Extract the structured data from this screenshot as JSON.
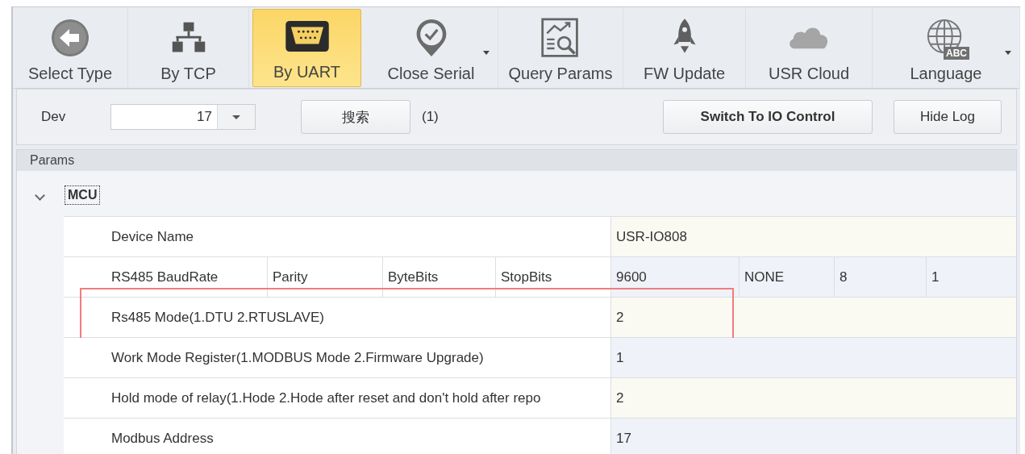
{
  "toolbar": {
    "buttons": [
      {
        "kind": "back",
        "label": "Select Type",
        "selected": false,
        "dropdown": false
      },
      {
        "kind": "network",
        "label": "By TCP",
        "selected": false,
        "dropdown": false
      },
      {
        "kind": "serial",
        "label": "By UART",
        "selected": true,
        "dropdown": false
      },
      {
        "kind": "pin",
        "label": "Close Serial",
        "selected": false,
        "dropdown": true
      },
      {
        "kind": "query",
        "label": "Query Params",
        "selected": false,
        "dropdown": false
      },
      {
        "kind": "rocket",
        "label": "FW Update",
        "selected": false,
        "dropdown": false
      },
      {
        "kind": "cloud",
        "label": "USR Cloud",
        "selected": false,
        "dropdown": false
      },
      {
        "kind": "globe",
        "label": "Language",
        "badge": "ABC",
        "selected": false,
        "dropdown": true
      }
    ]
  },
  "device_bar": {
    "label": "Dev",
    "value": "17",
    "search_button": "搜索",
    "count": "(1)",
    "switch_button": "Switch To IO Control",
    "log_button": "Hide Log"
  },
  "params": {
    "title": "Params",
    "group": {
      "label": "MCU",
      "expanded": true,
      "rows": [
        {
          "kind": "single",
          "label": "Device Name",
          "value": "USR-IO808",
          "annotated": false
        },
        {
          "kind": "multi",
          "labels": [
            "RS485 BaudRate",
            "Parity",
            "ByteBits",
            "StopBits"
          ],
          "values": [
            "9600",
            "NONE",
            "8",
            "1"
          ],
          "annotated": false
        },
        {
          "kind": "single",
          "label": "Rs485 Mode(1.DTU 2.RTUSLAVE)",
          "value": "2",
          "annotated": true
        },
        {
          "kind": "single",
          "label": "Work Mode Register(1.MODBUS Mode 2.Firmware Upgrade)",
          "value": "1",
          "annotated": false
        },
        {
          "kind": "single",
          "label": "Hold mode of relay(1.Hode 2.Hode after reset and don't hold after repo",
          "value": "2",
          "annotated": false
        },
        {
          "kind": "single",
          "label": "Modbus Address",
          "value": "17",
          "annotated": false
        }
      ]
    }
  }
}
